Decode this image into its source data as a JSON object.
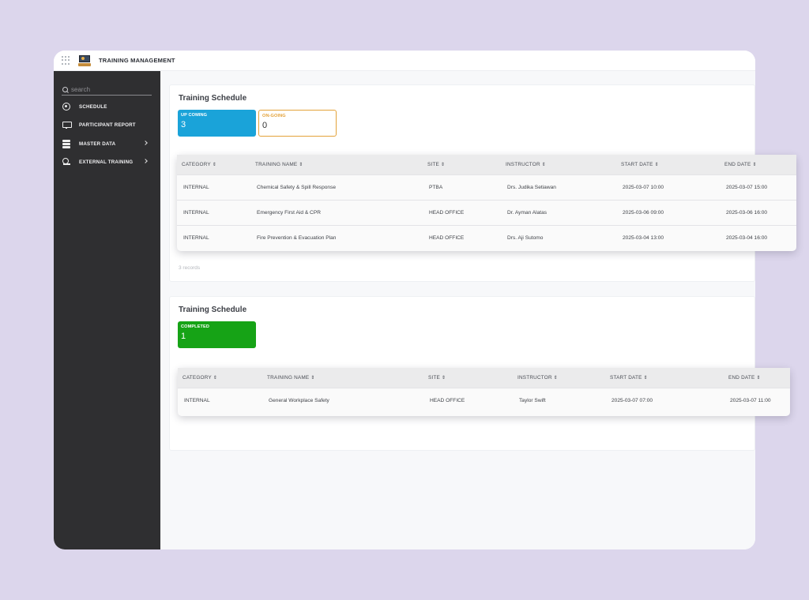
{
  "app": {
    "title": "TRAINING MANAGEMENT"
  },
  "sidebar": {
    "search_placeholder": "search",
    "items": [
      {
        "label": "SCHEDULE",
        "icon": "clock-icon"
      },
      {
        "label": "PARTICIPANT REPORT",
        "icon": "monitor-report-icon"
      },
      {
        "label": "MASTER DATA",
        "icon": "database-icon",
        "has_chevron": true
      },
      {
        "label": "EXTERNAL TRAINING",
        "icon": "external-user-icon",
        "has_chevron": true
      }
    ]
  },
  "section1": {
    "title": "Training Schedule",
    "stats": [
      {
        "label": "UP COMING",
        "value": "3",
        "color": "#1aa3d9"
      },
      {
        "label": "ON-GOING",
        "value": "0",
        "color": "#e3a23a"
      }
    ],
    "columns": [
      "CATEGORY",
      "TRAINING NAME",
      "SITE",
      "INSTRUCTOR",
      "START DATE",
      "END DATE"
    ],
    "rows": [
      [
        "INTERNAL",
        "Chemical Safety & Spill Response",
        "PTBA",
        "Drs. Judika Setiawan",
        "2025-03-07 10:00",
        "2025-03-07 15:00"
      ],
      [
        "INTERNAL",
        "Emergency First Aid & CPR",
        "HEAD OFFICE",
        "Dr. Ayman Alatas",
        "2025-03-06 09:00",
        "2025-03-06 16:00"
      ],
      [
        "INTERNAL",
        "Fire Prevention & Evacuation Plan",
        "HEAD OFFICE",
        "Drs. Aji Sutomo",
        "2025-03-04 13:00",
        "2025-03-04 16:00"
      ]
    ],
    "records": "3 records"
  },
  "section2": {
    "title": "Training Schedule",
    "stats": [
      {
        "label": "COMPLETED",
        "value": "1",
        "color": "#16a316"
      }
    ],
    "columns": [
      "CATEGORY",
      "TRAINING NAME",
      "SITE",
      "INSTRUCTOR",
      "START DATE",
      "END DATE"
    ],
    "rows": [
      [
        "INTERNAL",
        "General Workplace Safety",
        "HEAD OFFICE",
        "Taylor Swift",
        "2025-03-07 07:00",
        "2025-03-07 11:00"
      ]
    ]
  }
}
